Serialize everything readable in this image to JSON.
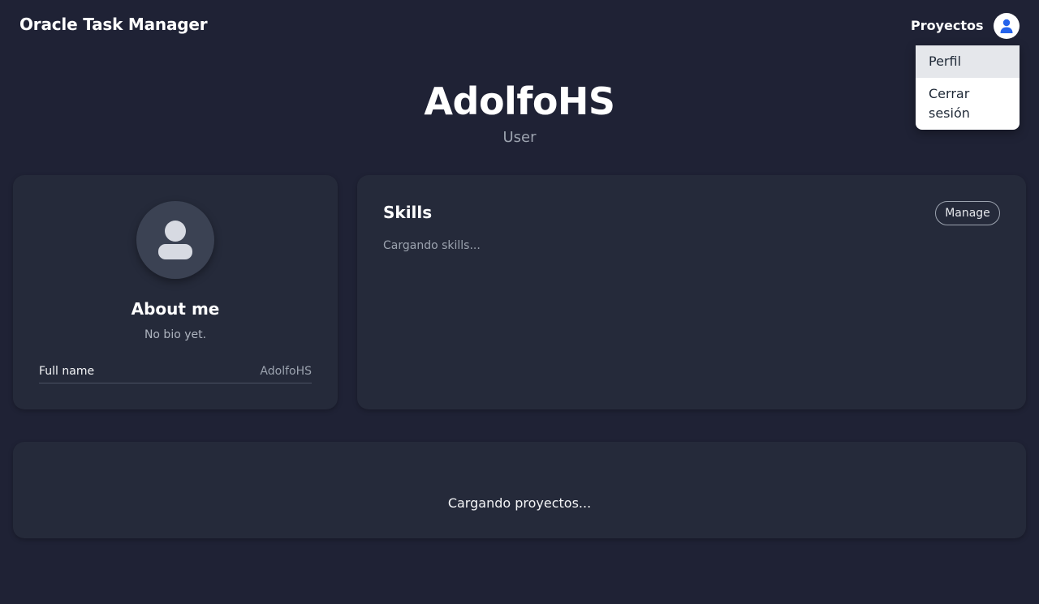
{
  "app": {
    "title": "Oracle Task Manager"
  },
  "nav": {
    "projects_link": "Proyectos",
    "user_menu_icon": "user-avatar-icon",
    "dropdown": {
      "items": [
        {
          "label": "Perfil",
          "highlighted": true
        },
        {
          "label": "Cerrar sesión",
          "highlighted": false
        }
      ]
    }
  },
  "profile": {
    "username": "AdolfoHS",
    "role": "User"
  },
  "about": {
    "avatar_icon": "user-silhouette-icon",
    "title": "About me",
    "bio": "No bio yet.",
    "fields": [
      {
        "label": "Full name",
        "value": "AdolfoHS"
      }
    ]
  },
  "skills": {
    "title": "Skills",
    "manage_label": "Manage",
    "loading_text": "Cargando skills..."
  },
  "projects": {
    "loading_text": "Cargando proyectos..."
  },
  "colors": {
    "background": "#1f2235",
    "card": "#252a3a",
    "avatar_accent": "#2563eb",
    "muted_text": "#9ca3af"
  }
}
